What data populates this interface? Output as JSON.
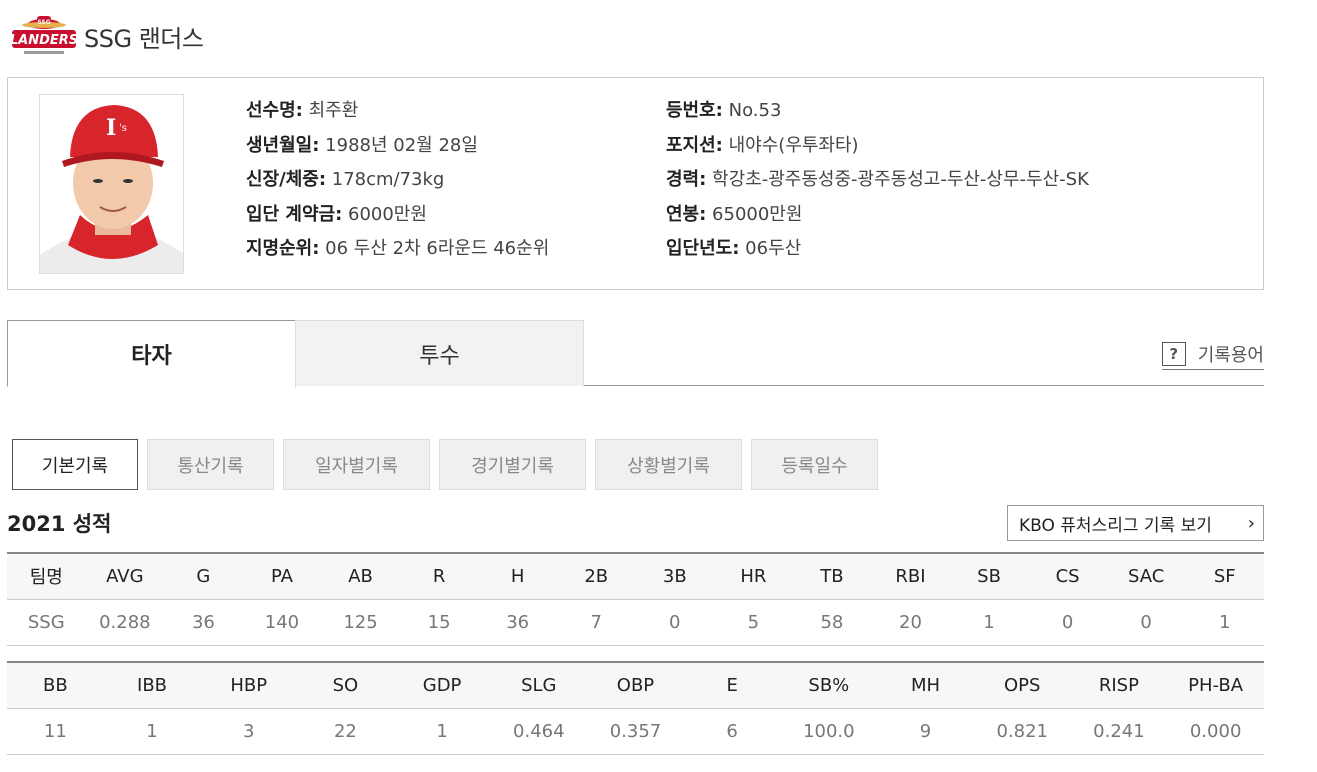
{
  "team": {
    "name": "SSG 랜더스",
    "logo_icon": "ssg-landers-logo"
  },
  "player": {
    "left": [
      {
        "k": "선수명:",
        "v": " 최주환"
      },
      {
        "k": "생년월일:",
        "v": " 1988년 02월 28일"
      },
      {
        "k": "신장/체중:",
        "v": " 178cm/73kg"
      },
      {
        "k": "입단 계약금:",
        "v": " 6000만원"
      },
      {
        "k": "지명순위:",
        "v": " 06 두산 2차 6라운드 46순위"
      }
    ],
    "right": [
      {
        "k": "등번호:",
        "v": " No.53"
      },
      {
        "k": "포지션:",
        "v": " 내야수(우투좌타)"
      },
      {
        "k": "경력:",
        "v": " 학강초-광주동성중-광주동성고-두산-상무-두산-SK"
      },
      {
        "k": "연봉:",
        "v": " 65000만원"
      },
      {
        "k": "입단년도:",
        "v": " 06두산"
      }
    ]
  },
  "tabs": {
    "batter": "타자",
    "pitcher": "투수",
    "glossary": "기록용어"
  },
  "subtabs": [
    {
      "label": "기본기록",
      "width": 126
    },
    {
      "label": "통산기록",
      "width": 127
    },
    {
      "label": "일자별기록",
      "width": 147
    },
    {
      "label": "경기별기록",
      "width": 147
    },
    {
      "label": "상황별기록",
      "width": 147
    },
    {
      "label": "등록일수",
      "width": 127
    }
  ],
  "season_title": "2021 성적",
  "futures_button": "KBO 퓨처스리그 기록 보기",
  "table1": {
    "headers": [
      "팀명",
      "AVG",
      "G",
      "PA",
      "AB",
      "R",
      "H",
      "2B",
      "3B",
      "HR",
      "TB",
      "RBI",
      "SB",
      "CS",
      "SAC",
      "SF"
    ],
    "row": [
      "SSG",
      "0.288",
      "36",
      "140",
      "125",
      "15",
      "36",
      "7",
      "0",
      "5",
      "58",
      "20",
      "1",
      "0",
      "0",
      "1"
    ]
  },
  "table2": {
    "headers": [
      "BB",
      "IBB",
      "HBP",
      "SO",
      "GDP",
      "SLG",
      "OBP",
      "E",
      "SB%",
      "MH",
      "OPS",
      "RISP",
      "PH-BA"
    ],
    "row": [
      "11",
      "1",
      "3",
      "22",
      "1",
      "0.464",
      "0.357",
      "6",
      "100.0",
      "9",
      "0.821",
      "0.241",
      "0.000"
    ]
  },
  "colors": {
    "cap_red": "#d8242b",
    "logo_red": "#c8102e",
    "border": "#cccccc"
  }
}
